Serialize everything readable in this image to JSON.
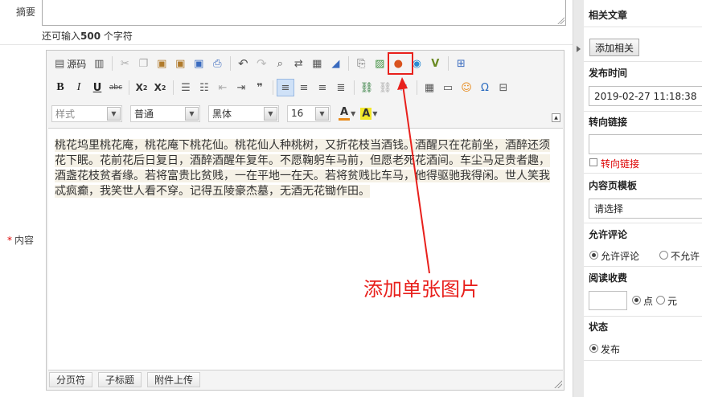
{
  "form": {
    "summary_label": "摘要",
    "counter_prefix": "还可输入",
    "counter_value": "500",
    "counter_suffix": "个字符",
    "content_required_mark": "*",
    "content_label": "内容"
  },
  "editor": {
    "source_label": "源码",
    "font_style": "样式",
    "font_format": "普通",
    "font_family": "黑体",
    "font_size": "16",
    "body_text": "桃花坞里桃花庵，桃花庵下桃花仙。桃花仙人种桃树，又折花枝当酒钱。酒醒只在花前坐，酒醉还须花下眠。花前花后日复日，酒醉酒醒年复年。不愿鞠躬车马前，但愿老死花酒间。车尘马足贵者趣，酒盏花枝贫者缘。若将富贵比贫贱，一在平地一在天。若将贫贱比车马，他得驱驰我得闲。世人笑我忒疯癫，我笑世人看不穿。记得五陵豪杰墓，无酒无花锄作田。",
    "footer": {
      "page_break": "分页符",
      "subtitle": "子标题",
      "upload": "附件上传"
    },
    "toolbar_glyphs": {
      "bold": "B",
      "italic": "I",
      "underline": "U",
      "strike": "abc",
      "subscript": "X",
      "subscript_mark": "2",
      "superscript": "X",
      "superscript_mark": "2",
      "blockquote": "❞",
      "font_color": "A",
      "bg_color": "A"
    }
  },
  "annotation": {
    "text": "添加单张图片",
    "color": "#e8201c"
  },
  "sidebar": {
    "related_title": "相关文章",
    "add_related": "添加相关",
    "publish_time_title": "发布时间",
    "publish_time": "2019-02-27 11:18:38",
    "redirect_title": "转向链接",
    "redirect_checkbox": "转向链接",
    "template_title": "内容页模板",
    "template_select": "请选择",
    "comment_title": "允许评论",
    "comment_allow": "允许评论",
    "comment_deny": "不允许",
    "fee_title": "阅读收费",
    "fee_unit_points": "点",
    "fee_unit_yuan": "元",
    "status_title": "状态",
    "status_publish": "发布"
  }
}
